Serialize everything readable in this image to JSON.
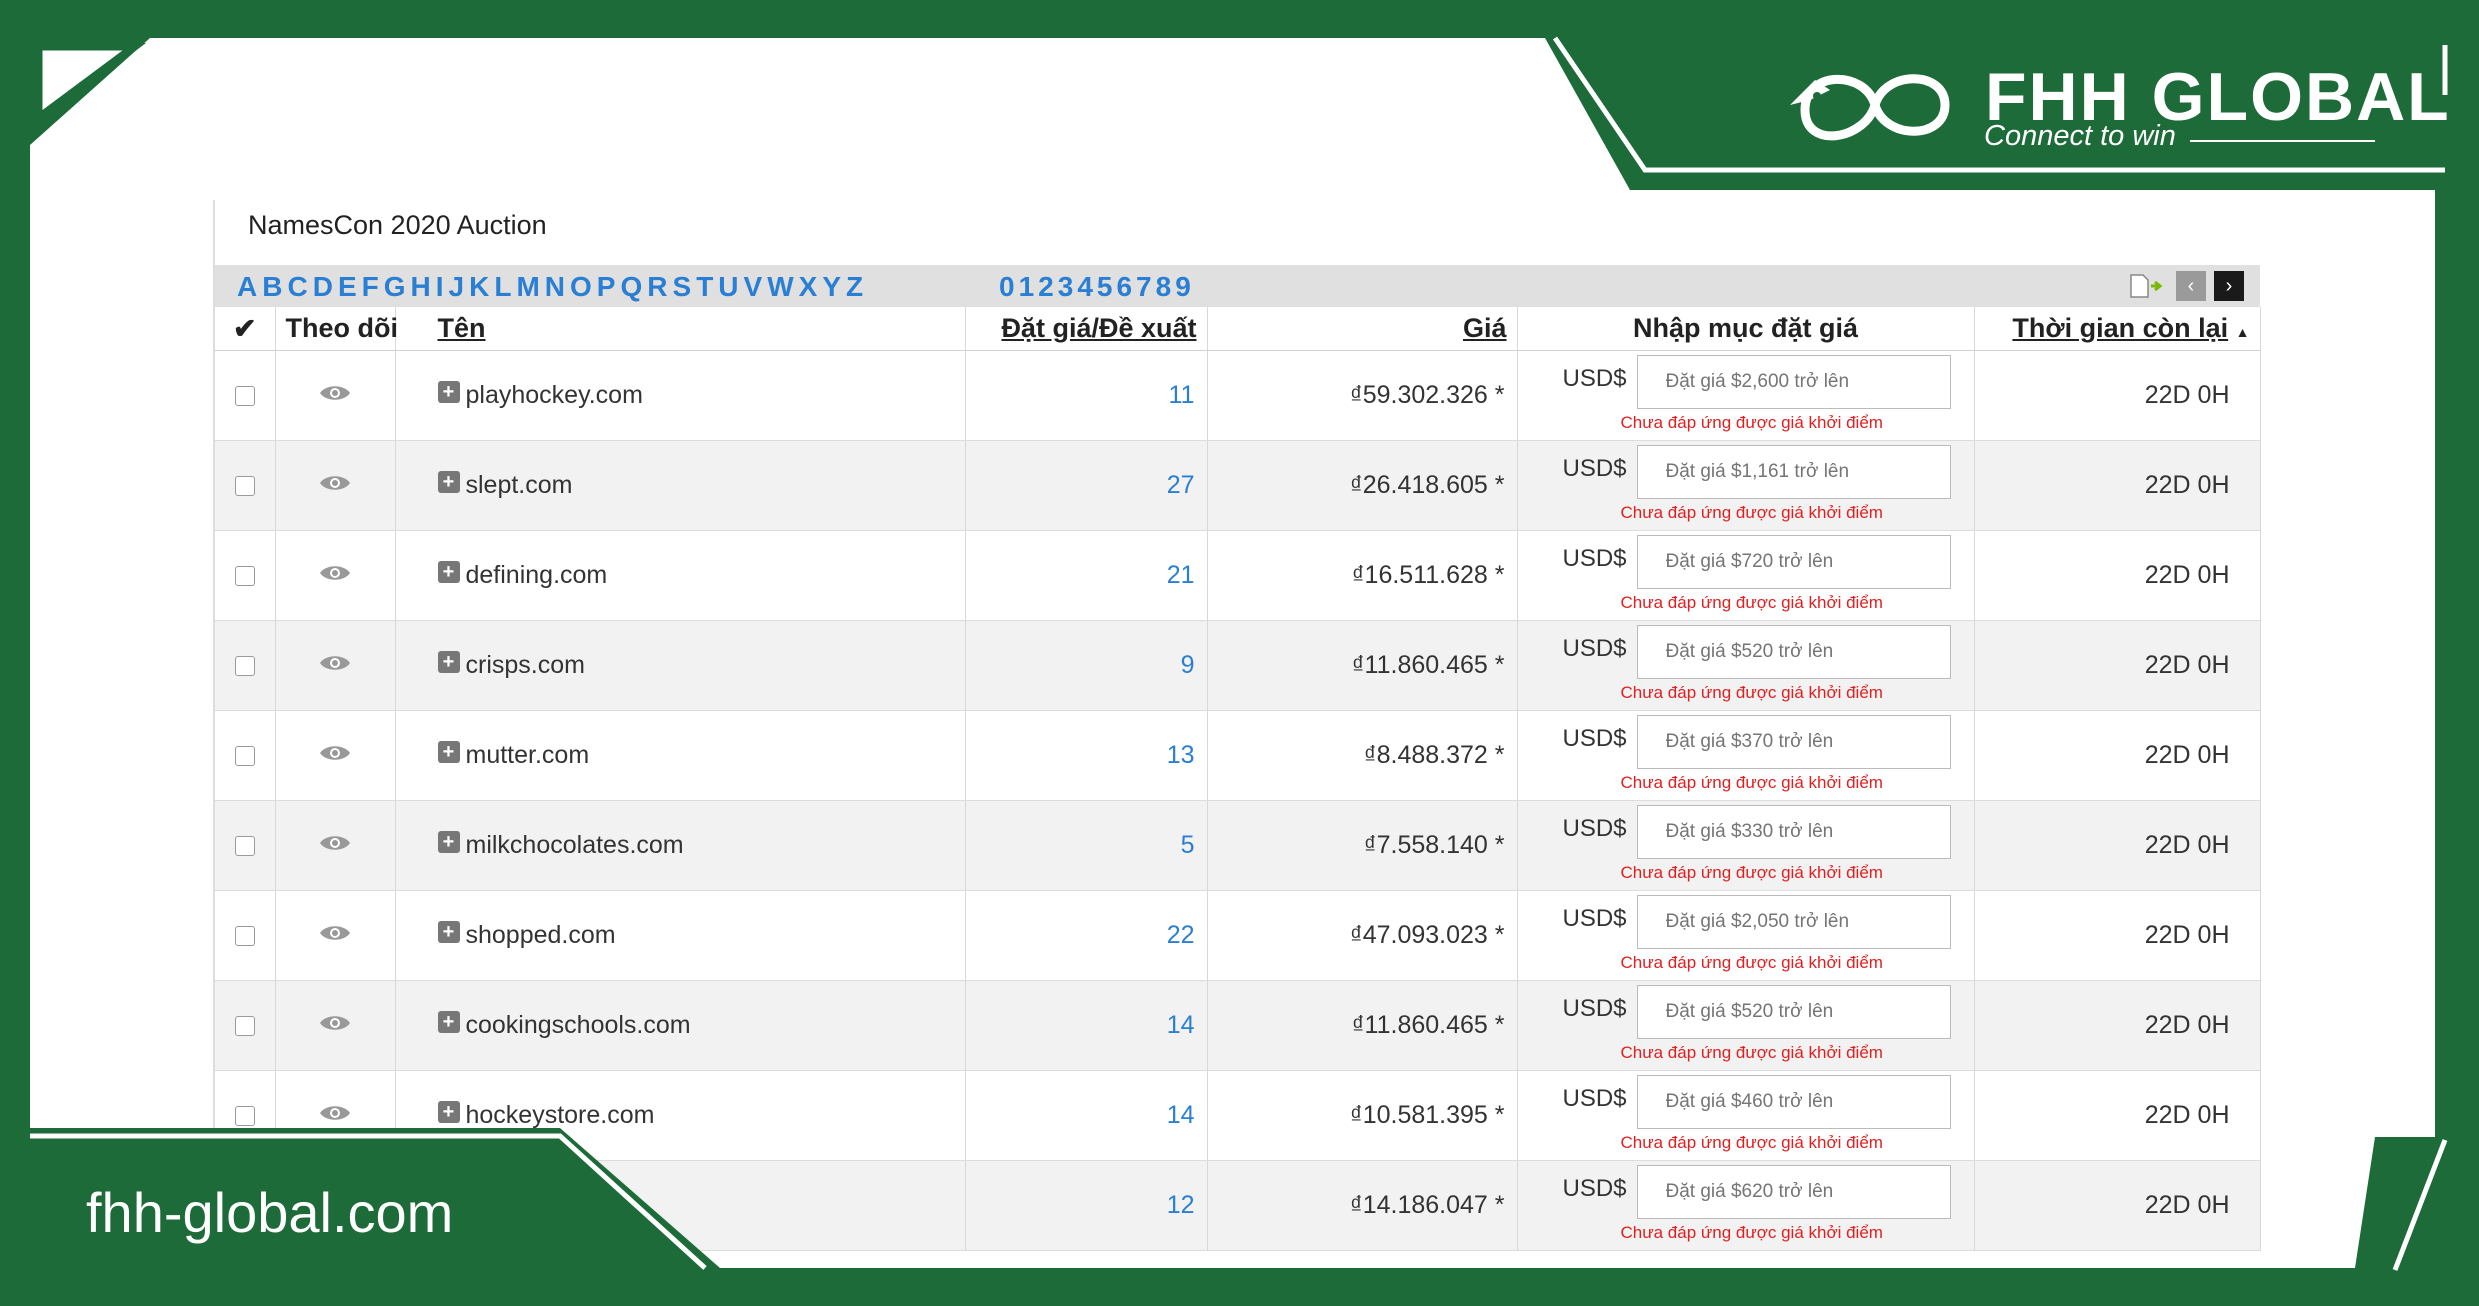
{
  "brand": {
    "name": "FHH GLOBAL",
    "tagline": "Connect to win",
    "website": "fhh-global.com",
    "green": "#1e6b3a"
  },
  "auction": {
    "title": "NamesCon 2020 Auction",
    "letters": [
      "A",
      "B",
      "C",
      "D",
      "E",
      "F",
      "G",
      "H",
      "I",
      "J",
      "K",
      "L",
      "M",
      "N",
      "O",
      "P",
      "Q",
      "R",
      "S",
      "T",
      "U",
      "V",
      "W",
      "X",
      "Y",
      "Z"
    ],
    "digits": [
      "0",
      "1",
      "2",
      "3",
      "4",
      "5",
      "6",
      "7",
      "8",
      "9"
    ],
    "pager_icons": [
      "export-icon",
      "prev-page-icon",
      "next-page-icon"
    ]
  },
  "table": {
    "headers": {
      "watch": "Theo dõi",
      "name": "Tên",
      "bids": "Đặt giá/Đề xuất",
      "price": "Giá",
      "entry": "Nhập mục đặt giá",
      "time": "Thời gian còn lại"
    },
    "currency_label": "USD$",
    "error_text": "Chưa đáp ứng được giá khởi điểm",
    "rows": [
      {
        "name": "playhockey.com",
        "bids": "11",
        "price": "₫59.302.326 *",
        "placeholder": "Đặt giá $2,600 trở lên",
        "time": "22D 0H"
      },
      {
        "name": "slept.com",
        "bids": "27",
        "price": "₫26.418.605 *",
        "placeholder": "Đặt giá $1,161 trở lên",
        "time": "22D 0H"
      },
      {
        "name": "defining.com",
        "bids": "21",
        "price": "₫16.511.628 *",
        "placeholder": "Đặt giá $720 trở lên",
        "time": "22D 0H"
      },
      {
        "name": "crisps.com",
        "bids": "9",
        "price": "₫11.860.465 *",
        "placeholder": "Đặt giá $520 trở lên",
        "time": "22D 0H"
      },
      {
        "name": "mutter.com",
        "bids": "13",
        "price": "₫8.488.372 *",
        "placeholder": "Đặt giá $370 trở lên",
        "time": "22D 0H"
      },
      {
        "name": "milkchocolates.com",
        "bids": "5",
        "price": "₫7.558.140 *",
        "placeholder": "Đặt giá $330 trở lên",
        "time": "22D 0H"
      },
      {
        "name": "shopped.com",
        "bids": "22",
        "price": "₫47.093.023 *",
        "placeholder": "Đặt giá $2,050 trở lên",
        "time": "22D 0H"
      },
      {
        "name": "cookingschools.com",
        "bids": "14",
        "price": "₫11.860.465 *",
        "placeholder": "Đặt giá $520 trở lên",
        "time": "22D 0H"
      },
      {
        "name": "hockeystore.com",
        "bids": "14",
        "price": "₫10.581.395 *",
        "placeholder": "Đặt giá $460 trở lên",
        "time": "22D 0H"
      },
      {
        "name": "",
        "bids": "12",
        "price": "₫14.186.047 *",
        "placeholder": "Đặt giá $620 trở lên",
        "time": "22D 0H"
      }
    ]
  }
}
